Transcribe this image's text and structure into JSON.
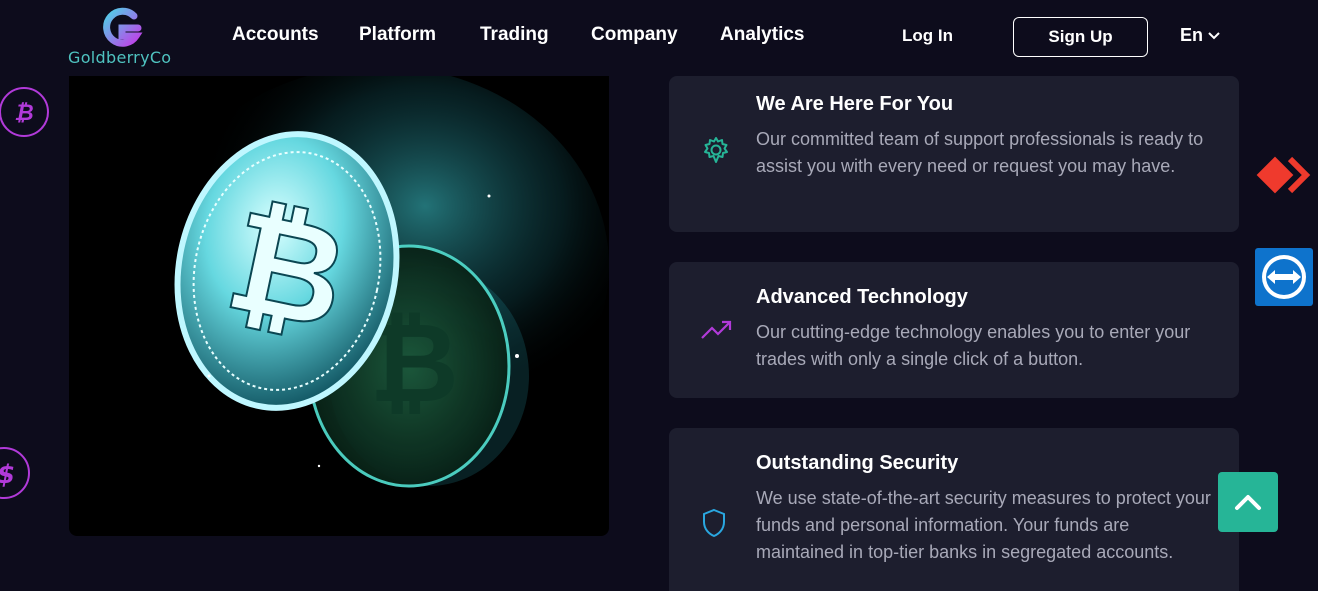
{
  "header": {
    "logo_text": "GoldberryCo",
    "nav": [
      "Accounts",
      "Platform",
      "Trading",
      "Company",
      "Analytics"
    ],
    "login_label": "Log In",
    "signup_label": "Sign Up",
    "language": "En"
  },
  "features": [
    {
      "title": "We Are Here For You",
      "text": "Our committed team of support professionals is ready to assist you with every need or request you may have.",
      "icon": "gear-icon"
    },
    {
      "title": "Advanced Technology",
      "text": "Our cutting-edge technology enables you to enter your trades with only a single click of a button.",
      "icon": "trending-up-icon"
    },
    {
      "title": "Outstanding Security",
      "text": "We use state-of-the-art security measures to protect your funds and personal information. Your funds are maintained in top-tier banks in segregated accounts.",
      "icon": "shield-icon"
    }
  ],
  "colors": {
    "background": "#0d0c1c",
    "card": "#1d1e2e",
    "accent_teal": "#26b597",
    "accent_purple": "#b13ad9"
  }
}
